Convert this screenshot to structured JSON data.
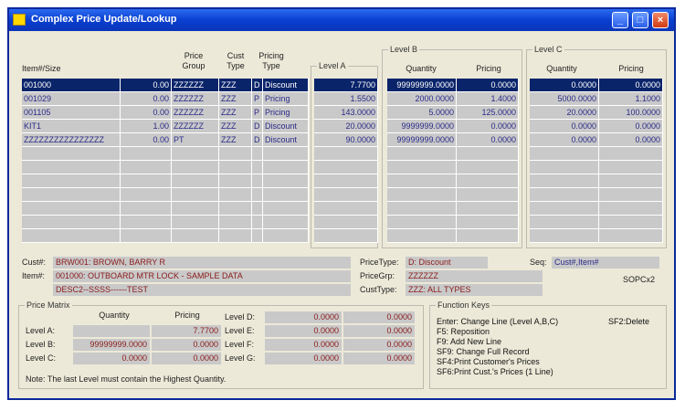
{
  "window": {
    "title": "Complex Price Update/Lookup"
  },
  "grid": {
    "headers": {
      "item": "Item#/Size",
      "price_group": "Price\nGroup",
      "cust_type": "Cust\nType",
      "pricing_type": "Pricing\nType",
      "level_a": "Level A",
      "level_b_group": "Level B",
      "level_c_group": "Level C",
      "quantity": "Quantity",
      "pricing": "Pricing"
    },
    "rows": [
      {
        "item": "001000",
        "size": "0.00",
        "pgroup": "ZZZZZZ",
        "ctype": "ZZZ",
        "code": "D",
        "ptype": "Discount",
        "la": "7.7700",
        "bq": "99999999.0000",
        "bp": "0.0000",
        "cq": "0.0000",
        "cp": "0.0000"
      },
      {
        "item": "001029",
        "size": "0.00",
        "pgroup": "ZZZZZZ",
        "ctype": "ZZZ",
        "code": "P",
        "ptype": "Pricing",
        "la": "1.5500",
        "bq": "2000.0000",
        "bp": "1.4000",
        "cq": "5000.0000",
        "cp": "1.1000"
      },
      {
        "item": "001105",
        "size": "0.00",
        "pgroup": "ZZZZZZ",
        "ctype": "ZZZ",
        "code": "P",
        "ptype": "Pricing",
        "la": "143.0000",
        "bq": "5.0000",
        "bp": "125.0000",
        "cq": "20.0000",
        "cp": "100.0000"
      },
      {
        "item": "KIT1",
        "size": "1.00",
        "pgroup": "ZZZZZZ",
        "ctype": "ZZZ",
        "code": "D",
        "ptype": "Discount",
        "la": "20.0000",
        "bq": "9999999.0000",
        "bp": "0.0000",
        "cq": "0.0000",
        "cp": "0.0000"
      },
      {
        "item": "ZZZZZZZZZZZZZZZZ",
        "size": "0.00",
        "pgroup": "PT",
        "ctype": "ZZZ",
        "code": "D",
        "ptype": "Discount",
        "la": "90.0000",
        "bq": "99999999.0000",
        "bp": "0.0000",
        "cq": "0.0000",
        "cp": "0.0000"
      }
    ],
    "selected_row": 0
  },
  "details": {
    "cust_label": "Cust#:",
    "cust_value": "BRW001: BROWN, BARRY R",
    "item_label": "Item#:",
    "item_value": "001000: OUTBOARD MTR LOCK - SAMPLE DATA",
    "desc_value": "DESC2--SSSS------TEST",
    "pricetype_label": "PriceType:",
    "pricetype_value": "D: Discount",
    "pricegrp_label": "PriceGrp:",
    "pricegrp_value": "ZZZZZZ",
    "custtype_label": "CustType:",
    "custtype_value": "ZZZ: ALL TYPES",
    "seq_label": "Seq:",
    "seq_value": "Cust#,Item#",
    "program": "SOPCx2"
  },
  "matrix": {
    "title": "Price Matrix",
    "qty_header": "Quantity",
    "pricing_header": "Pricing",
    "rows": [
      {
        "label": "Level A:",
        "qty": "",
        "price": "7.7700"
      },
      {
        "label": "Level B:",
        "qty": "99999999.0000",
        "price": "0.0000"
      },
      {
        "label": "Level C:",
        "qty": "0.0000",
        "price": "0.0000"
      }
    ],
    "rows2": [
      {
        "label": "Level D:",
        "qty": "0.0000",
        "price": "0.0000"
      },
      {
        "label": "Level E:",
        "qty": "0.0000",
        "price": "0.0000"
      },
      {
        "label": "Level F:",
        "qty": "0.0000",
        "price": "0.0000"
      },
      {
        "label": "Level G:",
        "qty": "0.0000",
        "price": "0.0000"
      }
    ],
    "note": "Note: The last Level must contain the Highest Quantity."
  },
  "function_keys": {
    "title": "Function Keys",
    "items": [
      "Enter: Change Line (Level A,B,C)",
      "F5: Reposition",
      "F9: Add New Line",
      "SF9: Change Full Record",
      "SF4:Print Customer's Prices",
      "SF6:Print Cust.'s Prices (1 Line)"
    ],
    "sf2": "SF2:Delete"
  }
}
